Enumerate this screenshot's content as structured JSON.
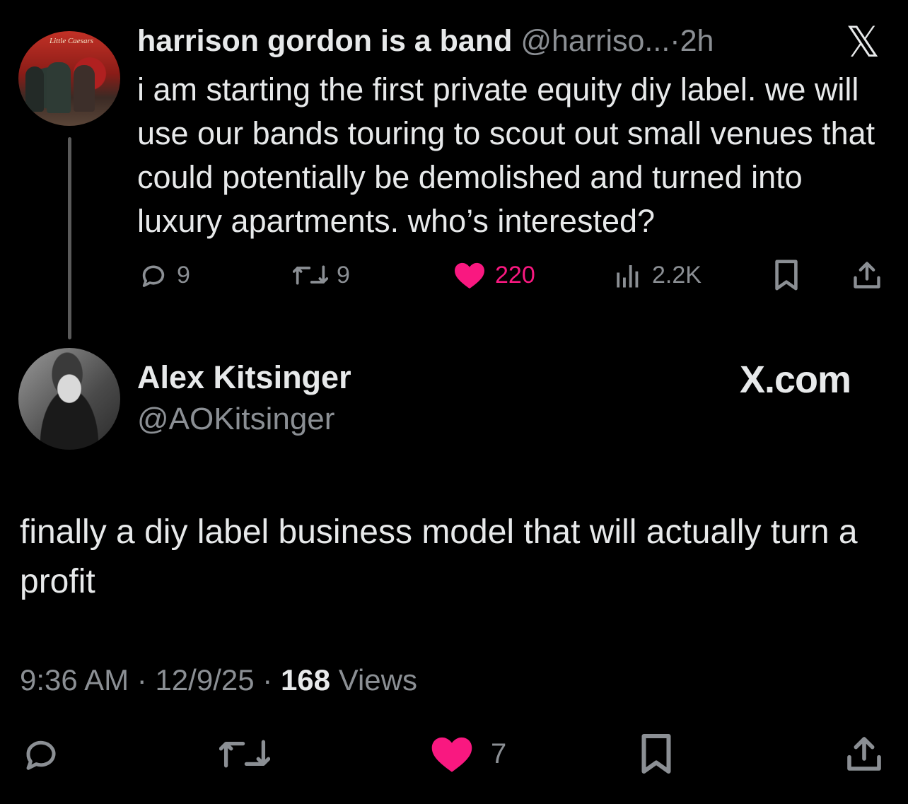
{
  "quoted_tweet": {
    "avatar_sign": "Little Caesars",
    "display_name": "harrison gordon is a band",
    "handle": "@harriso...",
    "separator": "·",
    "time": "2h",
    "platform_icon": "x-logo",
    "text": "i am starting the first private equity diy label. we will use our bands touring to scout out small venues that could potentially be demolished and turned into luxury apartments. who’s interested?",
    "actions": {
      "replies": "9",
      "reposts": "9",
      "likes": "220",
      "views": "2.2K"
    },
    "like_color": "#f91880"
  },
  "main_tweet": {
    "display_name": "Alex Kitsinger",
    "handle": "@AOKitsinger",
    "site_label": "X.com",
    "text": "finally a diy label business model that will actually turn a profit",
    "time": "9:36 AM",
    "date": "12/9/25",
    "separator": "·",
    "views_count": "168",
    "views_label": "Views",
    "actions": {
      "likes": "7"
    }
  }
}
